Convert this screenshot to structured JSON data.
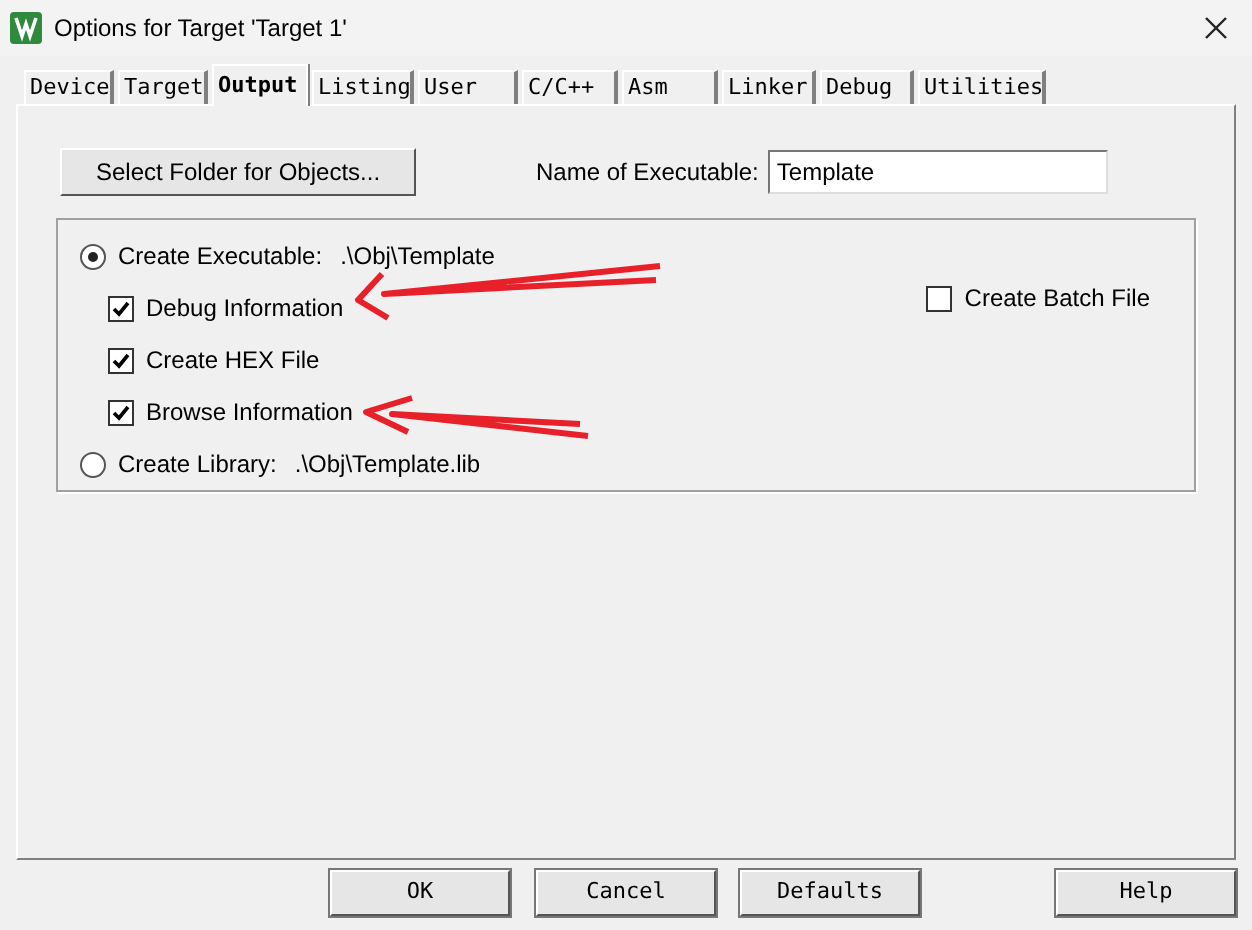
{
  "window": {
    "title": "Options for Target 'Target 1'"
  },
  "tabs": [
    {
      "label": "Device",
      "selected": false
    },
    {
      "label": "Target",
      "selected": false
    },
    {
      "label": "Output",
      "selected": true
    },
    {
      "label": "Listing",
      "selected": false
    },
    {
      "label": "User",
      "selected": false
    },
    {
      "label": "C/C++",
      "selected": false
    },
    {
      "label": "Asm",
      "selected": false
    },
    {
      "label": "Linker",
      "selected": false
    },
    {
      "label": "Debug",
      "selected": false
    },
    {
      "label": "Utilities",
      "selected": false
    }
  ],
  "output": {
    "select_folder_button": "Select Folder for Objects...",
    "executable_name": {
      "label": "Name of Executable:",
      "value": "Template"
    },
    "options": [
      {
        "kind": "radio",
        "label": "Create Executable:",
        "path": ".\\Obj\\Template",
        "selected": true
      },
      {
        "kind": "checkbox",
        "label": "Debug Information",
        "checked": true
      },
      {
        "kind": "checkbox",
        "label": "Create HEX File",
        "checked": true
      },
      {
        "kind": "checkbox",
        "label": "Browse Information",
        "checked": true
      },
      {
        "kind": "radio",
        "label": "Create Library:",
        "path": ".\\Obj\\Template.lib",
        "selected": false
      }
    ],
    "batch_file": {
      "label": "Create Batch File",
      "checked": false
    }
  },
  "buttons": [
    "OK",
    "Cancel",
    "Defaults",
    "Help"
  ]
}
